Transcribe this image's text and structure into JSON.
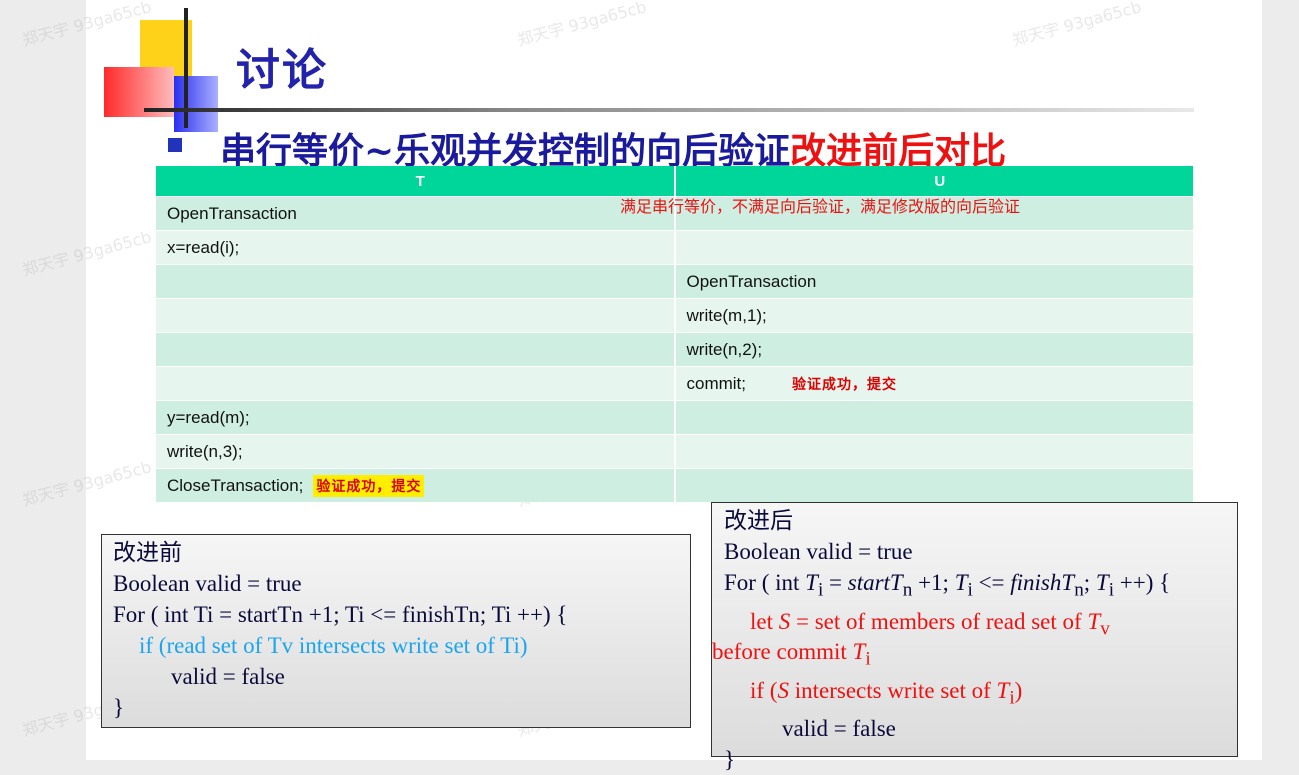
{
  "title": "讨论",
  "subtitle": {
    "blue": "串行等价~乐观并发控制的向后验证",
    "red": "改进前后对比"
  },
  "table": {
    "headers": [
      "T",
      "U"
    ],
    "note": "满足串行等价，不满足向后验证，满足修改版的向后验证",
    "rows": [
      {
        "t": "OpenTransaction",
        "u": ""
      },
      {
        "t": "x=read(i);",
        "u": ""
      },
      {
        "t": "",
        "u": "OpenTransaction"
      },
      {
        "t": "",
        "u": "write(m,1);"
      },
      {
        "t": "",
        "u": "write(n,2);"
      },
      {
        "t": "",
        "u": "commit;",
        "u_badge": "验证成功，提交"
      },
      {
        "t": "y=read(m);",
        "u": ""
      },
      {
        "t": "write(n,3);",
        "u": ""
      },
      {
        "t": "CloseTransaction;",
        "t_badge": "验证成功，提交",
        "u": ""
      }
    ]
  },
  "before": {
    "heading": "改进前",
    "lines": [
      "Boolean valid = true",
      "For ( int Ti = startTn +1; Ti <= finishTn; Ti ++) {",
      "if (read set of Tv intersects write set of Ti)",
      "valid = false",
      "}"
    ]
  },
  "after": {
    "heading": "改进后",
    "l1": "Boolean valid = true",
    "l2": {
      "a": "For ( int ",
      "T": "T",
      "i": "i",
      "eq": " = ",
      "start": "startT",
      "n": "n",
      "b": " +1; ",
      "le": " <= ",
      "finish": "finishT",
      "semi": "; ",
      "inc": " ++) {"
    },
    "l3": {
      "a": "let ",
      "S": "S",
      "b": " = set of members of read set of ",
      "T": "T",
      "v": "v"
    },
    "l4": {
      "a": "before commit ",
      "T": "T",
      "i": "i"
    },
    "l5": {
      "a": "if (",
      "S": "S",
      "b": " intersects write set of ",
      "T": "T",
      "i": "i",
      "c": ")"
    },
    "l6": "valid = false",
    "l7": "}"
  },
  "watermark": "郑天宇 93ga65cb",
  "colors": {
    "title": "#2222aa",
    "subtitle_red": "#ee1111",
    "table_header": "#00d69a",
    "row_odd": "#cdeee0",
    "row_even": "#e6f6ee",
    "badge_highlight": "#ffee00",
    "code_cyan": "#1aa5ee"
  }
}
